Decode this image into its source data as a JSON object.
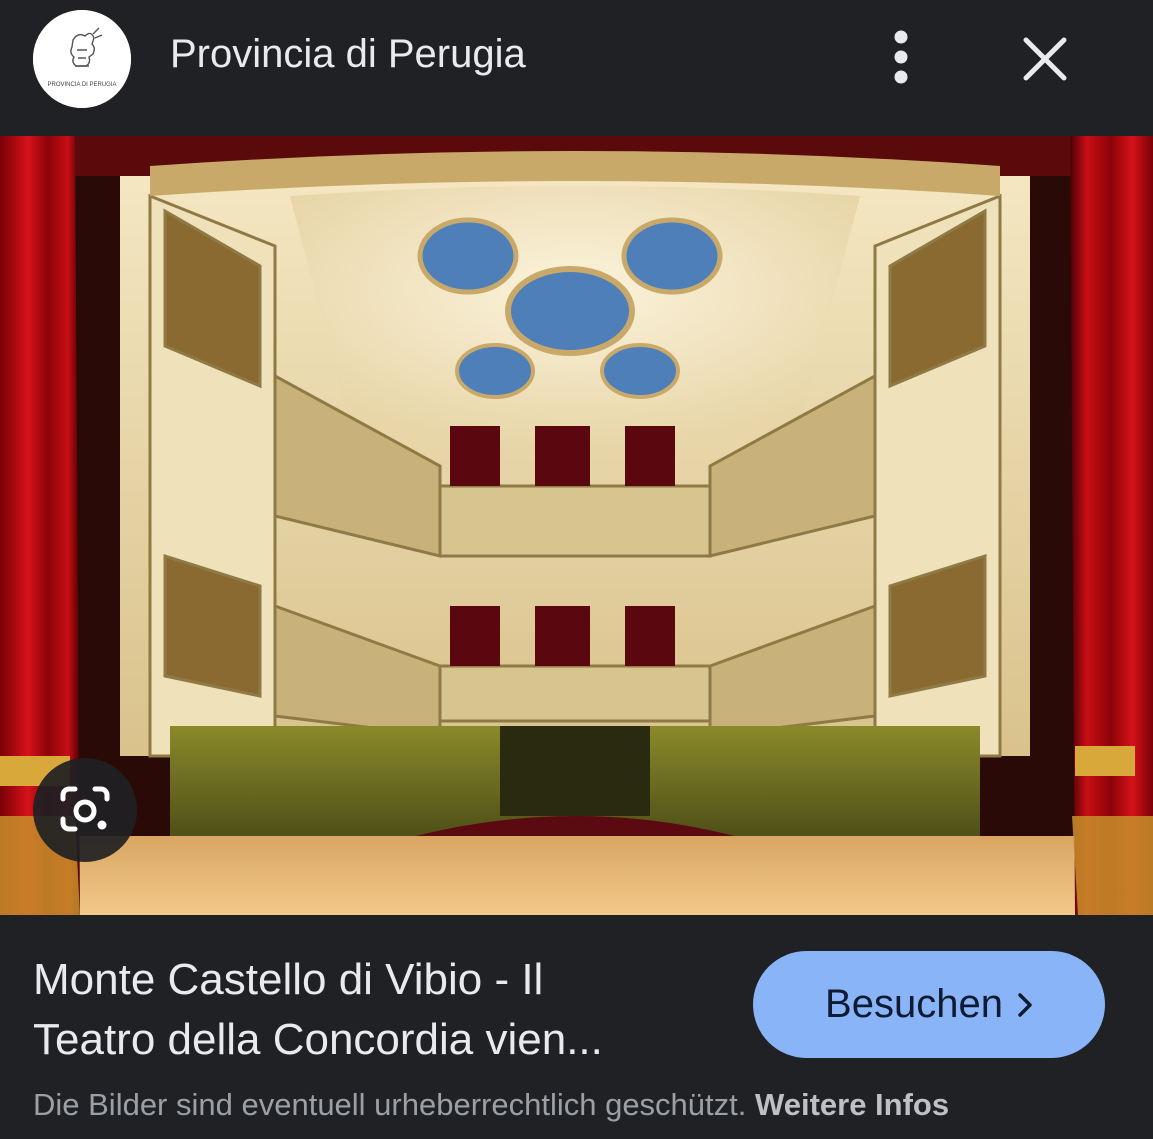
{
  "header": {
    "source_name": "Provincia di Perugia",
    "logo_text": "PROVINCIA DI PERUGIA",
    "menu_icon": "more-vert-icon",
    "close_icon": "close-icon"
  },
  "image": {
    "lens_icon": "google-lens-icon"
  },
  "caption": {
    "line1": "Monte Castello di Vibio - Il",
    "line2": "Teatro della Concordia vien..."
  },
  "visit_button": {
    "label": "Besuchen",
    "icon": "chevron-right-icon"
  },
  "footer": {
    "notice": "Die Bilder sind eventuell urheberrechtlich geschützt.",
    "more_link": "Weitere Infos"
  },
  "colors": {
    "background": "#202124",
    "text": "#e8eaed",
    "button": "#8ab4f8",
    "muted": "#9aa0a6"
  }
}
